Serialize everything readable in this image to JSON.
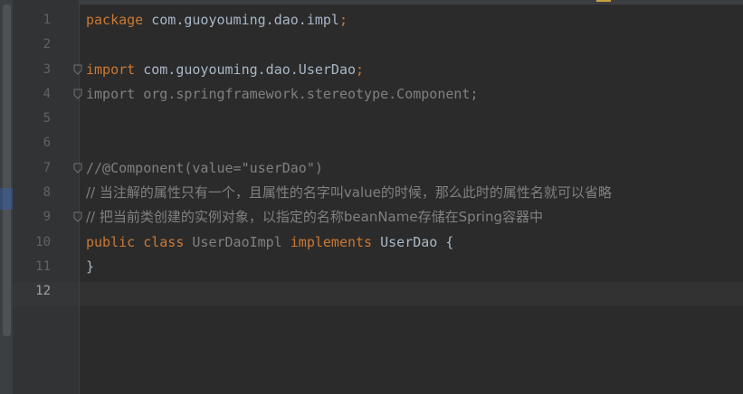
{
  "editor": {
    "active_line": 12,
    "lines": [
      {
        "n": "1",
        "tokens": [
          {
            "t": "package ",
            "c": "kw"
          },
          {
            "t": "com.guoyouming.dao.impl",
            "c": "plain"
          },
          {
            "t": ";",
            "c": "punct"
          }
        ]
      },
      {
        "n": "2",
        "tokens": []
      },
      {
        "n": "3",
        "fold": true,
        "tokens": [
          {
            "t": "import ",
            "c": "kw"
          },
          {
            "t": "com.guoyouming.dao.UserDao",
            "c": "plain"
          },
          {
            "t": ";",
            "c": "punct"
          }
        ]
      },
      {
        "n": "4",
        "fold": true,
        "tokens": [
          {
            "t": "import ",
            "c": "unused"
          },
          {
            "t": "org.springframework.stereotype.Component",
            "c": "unused"
          },
          {
            "t": ";",
            "c": "unused"
          }
        ]
      },
      {
        "n": "5",
        "tokens": []
      },
      {
        "n": "6",
        "tokens": []
      },
      {
        "n": "7",
        "fold": true,
        "tokens": [
          {
            "t": "//@Component(value=\"userDao\")",
            "c": "comment"
          }
        ]
      },
      {
        "n": "8",
        "tokens": [
          {
            "t": "// 当注解的属性只有一个，且属性的名字叫value的时候，那么此时的属性名就可以省略",
            "c": "comment cjk"
          }
        ]
      },
      {
        "n": "9",
        "fold": true,
        "tokens": [
          {
            "t": "// 把当前类创建的实例对象，以指定的名称beanName存储在Spring容器中",
            "c": "comment cjk"
          }
        ]
      },
      {
        "n": "10",
        "tokens": [
          {
            "t": "public ",
            "c": "kw"
          },
          {
            "t": "class ",
            "c": "kw"
          },
          {
            "t": "UserDaoImpl ",
            "c": "unused"
          },
          {
            "t": "implements ",
            "c": "kw"
          },
          {
            "t": "UserDao ",
            "c": "plain"
          },
          {
            "t": "{",
            "c": "plain"
          }
        ]
      },
      {
        "n": "11",
        "tokens": [
          {
            "t": "}",
            "c": "plain"
          }
        ]
      },
      {
        "n": "12",
        "tokens": []
      }
    ]
  },
  "colors": {
    "background": "#2b2b2b",
    "gutter": "#313335",
    "keyword": "#cc7832",
    "identifier": "#a9b7c6",
    "comment": "#808080",
    "line_number": "#606366"
  },
  "icons": {
    "fold": "fold-marker-icon",
    "warning": "warning-icon"
  }
}
